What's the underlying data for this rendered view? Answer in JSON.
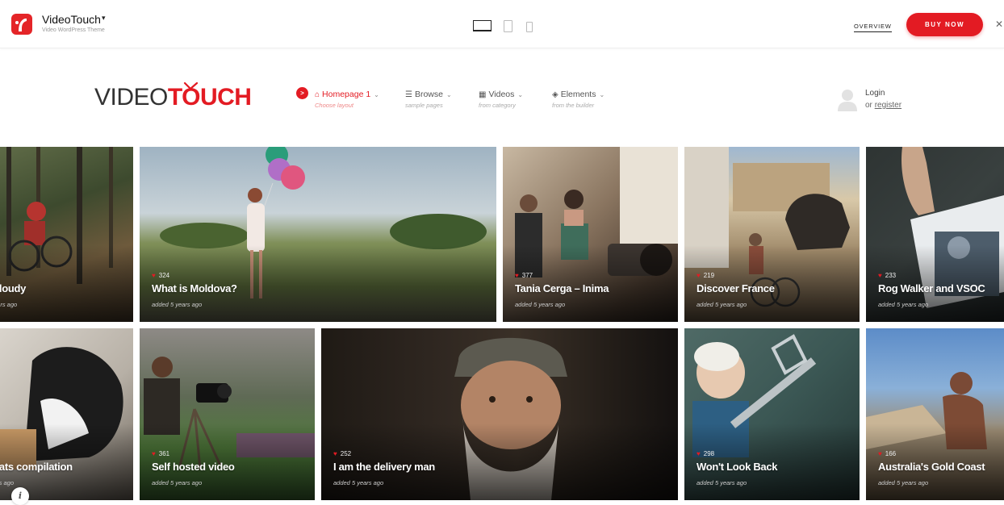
{
  "demo_bar": {
    "brand_name": "VideoTouch",
    "brand_caret": "▾",
    "brand_subtitle": "Video WordPress Theme",
    "overview_label": "OVERVIEW",
    "buy_label": "BUY NOW",
    "close_glyph": "✕",
    "devices": [
      "desktop-icon",
      "tablet-icon",
      "phone-icon"
    ]
  },
  "header": {
    "logo_part1": "VIDEO",
    "logo_part2": "TOUCH",
    "nav": [
      {
        "label": "Homepage 1",
        "sub": "Choose layout",
        "icon": "home-icon",
        "glyph": "⌂",
        "caret": "⌄"
      },
      {
        "label": "Browse",
        "sub": "sample pages",
        "icon": "menu-icon",
        "glyph": "☰",
        "caret": "⌄"
      },
      {
        "label": "Videos",
        "sub": "from category",
        "icon": "film-icon",
        "glyph": "▦",
        "caret": "⌄"
      },
      {
        "label": "Elements",
        "sub": "from the builder",
        "icon": "cube-icon",
        "glyph": "◈",
        "caret": "⌄"
      }
    ],
    "nav_arrow": ">",
    "login_label": "Login",
    "or_label": "or",
    "register_label": "register"
  },
  "videos": [
    {
      "title": "cloudy",
      "likes": "",
      "added": "ears ago"
    },
    {
      "title": "What is Moldova?",
      "likes": "324",
      "added": "added 5 years ago"
    },
    {
      "title": "Tania Cerga – Inima",
      "likes": "377",
      "added": "added 5 years ago"
    },
    {
      "title": "Discover France",
      "likes": "219",
      "added": "added 5 years ago"
    },
    {
      "title": "Rog Walker and VSOC",
      "likes": "233",
      "added": "added 5 years ago"
    },
    {
      "title": "cats compilation",
      "likes": "",
      "added": "ars ago"
    },
    {
      "title": "Self hosted video",
      "likes": "361",
      "added": "added 5 years ago"
    },
    {
      "title": "I am the delivery man",
      "likes": "252",
      "added": "added 5 years ago"
    },
    {
      "title": "Won't Look Back",
      "likes": "298",
      "added": "added 5 years ago"
    },
    {
      "title": "Australia's Gold Coast",
      "likes": "166",
      "added": "added 5 years ago"
    }
  ],
  "heart_glyph": "♥",
  "info_glyph": "i",
  "colors": {
    "accent": "#e31b23",
    "text": "#333333"
  }
}
